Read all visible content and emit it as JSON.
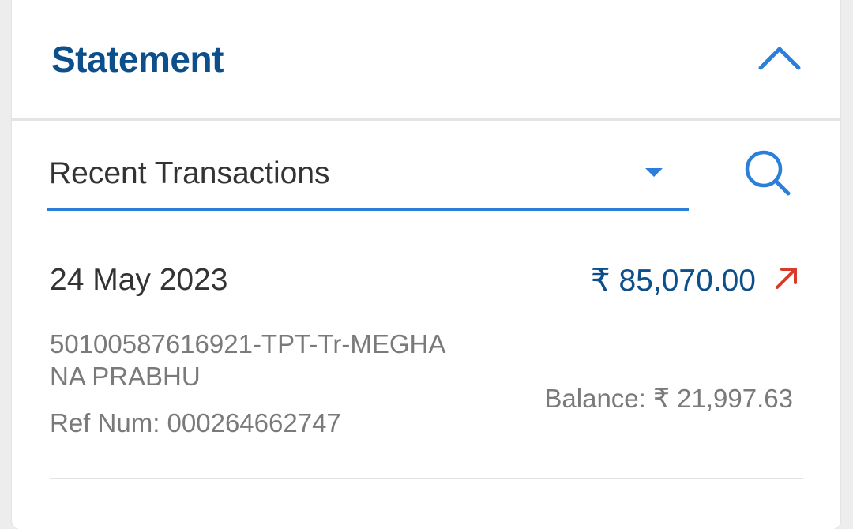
{
  "header": {
    "title": "Statement",
    "collapse_icon": "chevron-up-icon"
  },
  "filter": {
    "selected": "Recent Transactions",
    "dropdown_icon": "caret-down-icon",
    "search_icon": "search-icon"
  },
  "colors": {
    "brand": "#0d4f8b",
    "accent": "#2b7fd9",
    "debit": "#d93a2b"
  },
  "transactions": [
    {
      "date": "24 May 2023",
      "amount": "₹ 85,070.00",
      "direction_icon": "arrow-up-right-icon",
      "description": "50100587616921-TPT-Tr-MEGHANA PRABHU",
      "ref_label": "Ref Num:",
      "ref_number": "000264662747",
      "balance_label": "Balance:",
      "balance": "₹ 21,997.63"
    }
  ]
}
